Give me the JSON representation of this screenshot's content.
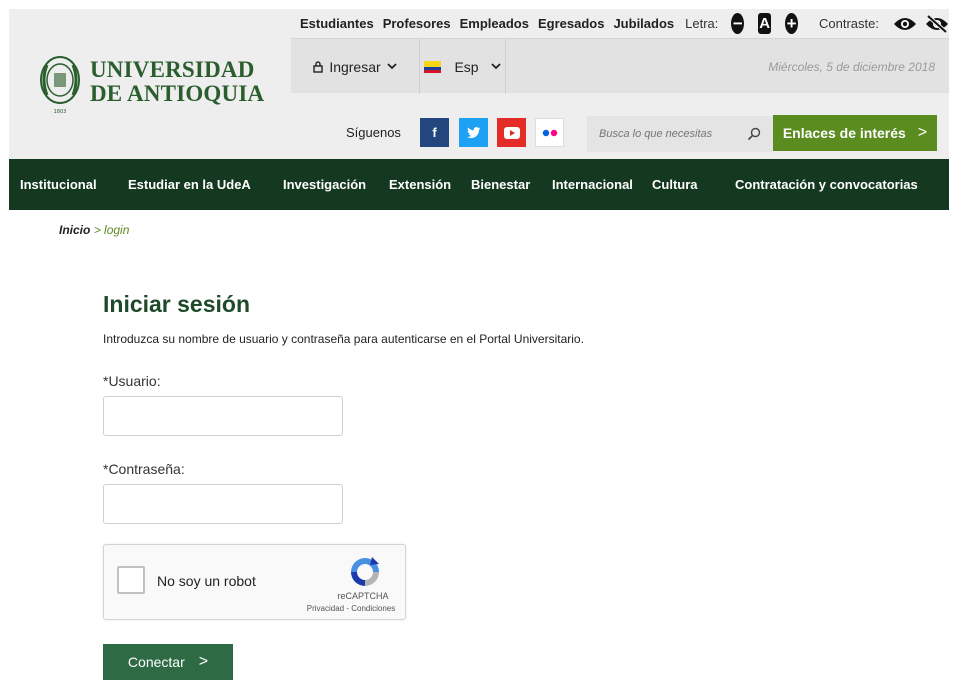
{
  "header": {
    "logo_line1": "UNIVERSIDAD",
    "logo_line2": "DE ANTIOQUIA",
    "top_links": [
      "Estudiantes",
      "Profesores",
      "Empleados",
      "Egresados",
      "Jubilados"
    ],
    "letra_label": "Letra:",
    "letra_decrease": "−",
    "letra_normal": "A",
    "letra_increase": "+",
    "contraste_label": "Contraste:",
    "ingresar_label": "Ingresar",
    "lang_label": "Esp",
    "date": "Miércoles, 5 de diciembre 2018",
    "siguenos_label": "Síguenos",
    "social": [
      {
        "name": "facebook-icon",
        "glyph": "f"
      },
      {
        "name": "twitter-icon",
        "glyph": ""
      },
      {
        "name": "youtube-icon",
        "glyph": ""
      },
      {
        "name": "flickr-icon",
        "glyph": ""
      }
    ],
    "search_placeholder": "Busca lo que necesitas",
    "enlaces_label": "Enlaces de interés",
    "enlaces_chevron": ">"
  },
  "nav": {
    "items": [
      "Institucional",
      "Estudiar en la UdeA",
      "Investigación",
      "Extensión",
      "Bienestar",
      "Internacional",
      "Cultura",
      "Contratación y convocatorias"
    ]
  },
  "breadcrumb": {
    "home": "Inicio",
    "separator": ">",
    "current": "login"
  },
  "login": {
    "title": "Iniciar sesión",
    "intro": "Introduzca su nombre de usuario y contraseña para autenticarse en el Portal Universitario.",
    "username_label": "*Usuario:",
    "username_value": "",
    "password_label": "*Contraseña:",
    "password_value": "",
    "captcha_text": "No soy un robot",
    "captcha_brand": "reCAPTCHA",
    "captcha_links": "Privacidad - Condiciones",
    "submit_label": "Conectar",
    "submit_chevron": ">"
  },
  "colors": {
    "brand_green": "#2b5e2e",
    "nav_bg": "#143920",
    "accent_green": "#5b8c1f",
    "button_green": "#2e6b45"
  }
}
